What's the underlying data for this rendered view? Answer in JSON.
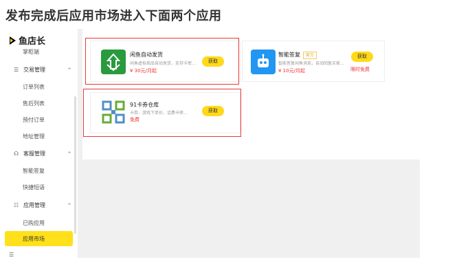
{
  "heading": "发布完成后应用市场进入下面两个应用",
  "sidebar": {
    "logo": "鱼店长",
    "partial_item": "掌柜端",
    "groups": [
      {
        "icon": "☰",
        "label": "交易管理",
        "items": [
          "订单列表",
          "售后列表",
          "预付订单",
          "地址管理"
        ]
      },
      {
        "icon": "☊",
        "label": "客服管理",
        "items": [
          "智能答复",
          "快捷短语"
        ]
      },
      {
        "icon": "☷",
        "label": "应用管理",
        "items": [
          "已购应用",
          "应用市场"
        ]
      }
    ],
    "active": "应用市场",
    "collapse_icon": "☰"
  },
  "apps": [
    {
      "name": "闲鱼自动发货",
      "desc": "闲鱼虚拟商品自动发货，支持卡密...",
      "price": "¥ 30元/月起",
      "button": "获取",
      "icon_color": "#2a9a3e"
    },
    {
      "name": "智能答复",
      "tag": "官方",
      "desc": "智能答复闲鱼消息，自动回复买家...",
      "price": "¥ 10元/月起",
      "button": "获取",
      "limited": "限时免费",
      "icon_color": "#2196f3"
    },
    {
      "name": "91卡券仓库",
      "desc": "卡券、游戏下单价、话费卡密...",
      "price": "免费",
      "button": "获取",
      "icon_color": "#4f8fc8"
    }
  ]
}
